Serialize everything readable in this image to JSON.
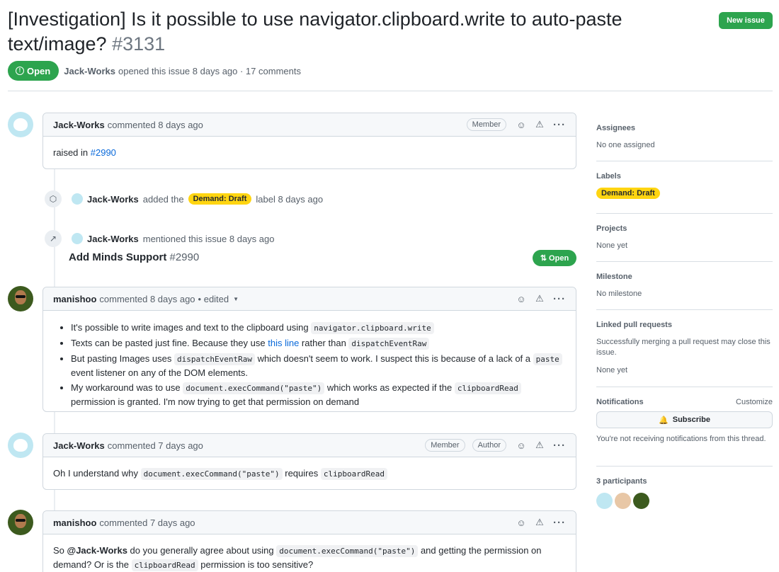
{
  "issue": {
    "title": "[Investigation] Is it possible to use navigator.clipboard.write to auto-paste text/image?",
    "number": "#3131",
    "state": "Open",
    "author": "Jack-Works",
    "opened_text": "opened this issue 8 days ago · 17 comments"
  },
  "header": {
    "new_issue_label": "New issue"
  },
  "comments": [
    {
      "author": "Jack-Works",
      "time": "commented 8 days ago",
      "badges": [
        "Member"
      ],
      "body_prefix": "raised in ",
      "body_link": "#2990"
    },
    {
      "author": "manishoo",
      "time": "commented 8 days ago",
      "edited": "• edited",
      "bullets": [
        {
          "t1": "It's possible to write images and text to the clipboard using ",
          "c1": "navigator.clipboard.write"
        },
        {
          "t1": "Texts can be pasted just fine. Because they use ",
          "link": "this line",
          "t2": " rather than ",
          "c1": "dispatchEventRaw"
        },
        {
          "t1": "But pasting Images uses ",
          "c1": "dispatchEventRaw",
          "t2": " which doesn't seem to work. I suspect this is because of a lack of a ",
          "c2": "paste",
          "t3": " event listener on any of the DOM elements."
        },
        {
          "t1": "My workaround was to use ",
          "c1": "document.execCommand(\"paste\")",
          "t2": " which works as expected if the ",
          "c2": "clipboardRead",
          "t3": " permission is granted. I'm now trying to get that permission on demand"
        }
      ]
    },
    {
      "author": "Jack-Works",
      "time": "commented 7 days ago",
      "badges": [
        "Member",
        "Author"
      ],
      "t1": "Oh I understand why ",
      "c1": "document.execCommand(\"paste\")",
      "t2": " requires ",
      "c2": "clipboardRead"
    },
    {
      "author": "manishoo",
      "time": "commented 7 days ago",
      "t1": "So ",
      "mention": "@Jack-Works",
      "t2": " do you generally agree about using ",
      "c1": "document.execCommand(\"paste\")",
      "t3": " and getting the permission on demand? Or is the ",
      "c2": "clipboardRead",
      "t4": " permission is too sensitive?"
    }
  ],
  "events": {
    "label_event": {
      "actor": "Jack-Works",
      "pre": "added the",
      "label": "Demand: Draft",
      "post": "label 8 days ago",
      "label_color": "#ffd511"
    },
    "mention_event": {
      "actor": "Jack-Works",
      "text": "mentioned this issue 8 days ago",
      "ref_title": "Add Minds Support",
      "ref_number": "#2990",
      "ref_state": "Open"
    }
  },
  "sidebar": {
    "assignees": {
      "heading": "Assignees",
      "value": "No one assigned"
    },
    "labels": {
      "heading": "Labels",
      "label": "Demand: Draft"
    },
    "projects": {
      "heading": "Projects",
      "value": "None yet"
    },
    "milestone": {
      "heading": "Milestone",
      "value": "No milestone"
    },
    "linked_prs": {
      "heading": "Linked pull requests",
      "desc": "Successfully merging a pull request may close this issue.",
      "value": "None yet"
    },
    "notifications": {
      "heading": "Notifications",
      "customize": "Customize",
      "subscribe": "Subscribe",
      "desc": "You're not receiving notifications from this thread."
    },
    "participants": {
      "heading": "3 participants"
    }
  },
  "colors": {
    "open_green": "#2da44e",
    "link_blue": "#0969da",
    "label_yellow": "#ffd511"
  }
}
